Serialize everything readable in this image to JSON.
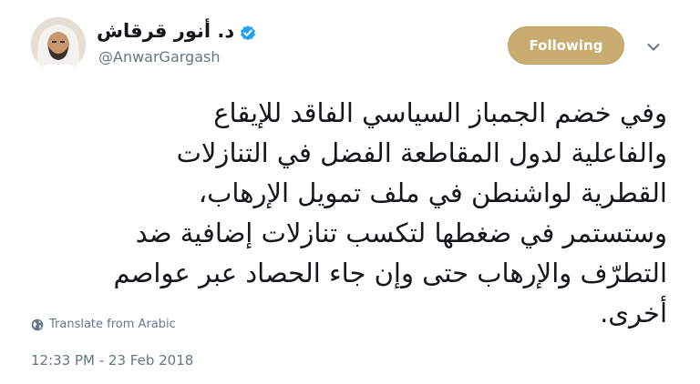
{
  "author": {
    "display_name": "د. أنور قرقاش",
    "handle": "@AnwarGargash",
    "verified": true
  },
  "actions": {
    "follow_label": "Following",
    "menu_icon": "chevron-down-icon"
  },
  "tweet": {
    "lines": [
      "وفي خضم الجمباز السياسي الفاقد للإيقاع",
      "والفاعلية لدول المقاطعة الفضل في التنازلات",
      "القطرية لواشنطن في ملف تمويل الإرهاب،",
      "وستستمر في ضغطها لتكسب تنازلات إضافية ضد",
      "التطرّف والإرهاب حتى وإن جاء الحصاد عبر عواصم",
      "أخرى."
    ],
    "translate_label": "Translate from Arabic",
    "timestamp": "12:33 PM - 23 Feb 2018"
  },
  "colors": {
    "follow_button_bg": "#c8ac70",
    "verified_badge": "#1da1f2",
    "secondary_text": "#657786"
  }
}
